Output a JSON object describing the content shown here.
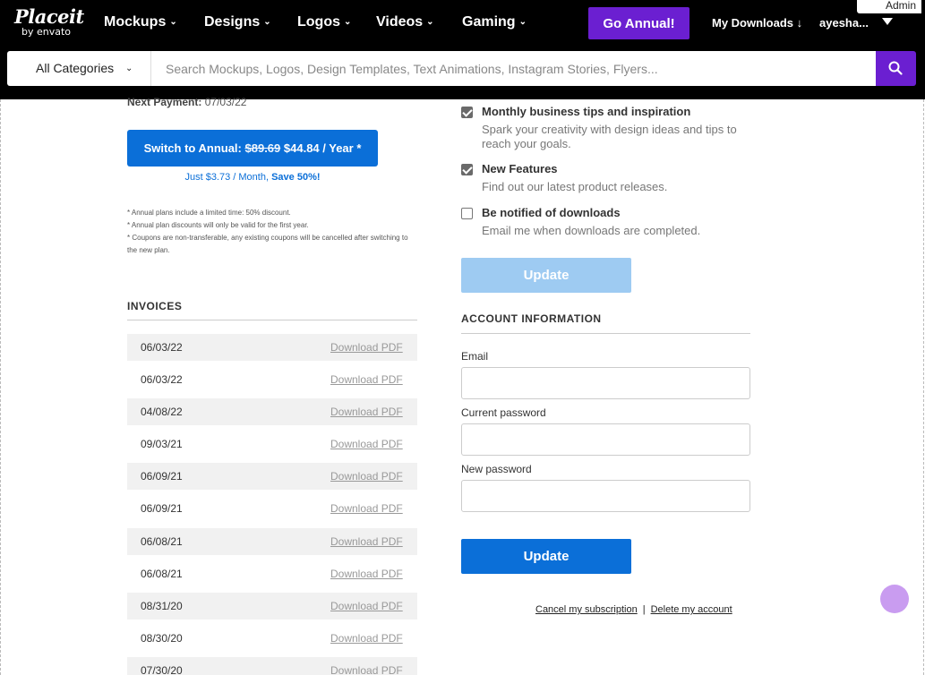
{
  "header": {
    "logo_brand": "Placeit",
    "logo_by": "by envato",
    "nav": [
      {
        "label": "Mockups"
      },
      {
        "label": "Designs"
      },
      {
        "label": "Logos"
      },
      {
        "label": "Videos"
      },
      {
        "label": "Gaming"
      }
    ],
    "go_annual": "Go Annual!",
    "my_downloads": "My Downloads",
    "user": "ayesha...",
    "admin": "Admin"
  },
  "search": {
    "category": "All Categories",
    "placeholder": "Search Mockups, Logos, Design Templates, Text Animations, Instagram Stories, Flyers..."
  },
  "billing": {
    "next_payment_label": "Next Payment:",
    "next_payment_date": "07/03/22",
    "switch_prefix": "Switch to Annual:",
    "old_price": "$89.69",
    "new_price": "$44.84 / Year *",
    "per_month": "Just $3.73 / Month,",
    "save": "Save 50%!",
    "notes": [
      "* Annual plans include a limited time: 50% discount.",
      "* Annual plan discounts will only be valid for the first year.",
      "* Coupons are non-transferable, any existing coupons will be cancelled after switching to the new plan."
    ]
  },
  "invoices": {
    "title": "INVOICES",
    "link_label": "Download PDF",
    "rows": [
      {
        "date": "06/03/22"
      },
      {
        "date": "06/03/22"
      },
      {
        "date": "04/08/22"
      },
      {
        "date": "09/03/21"
      },
      {
        "date": "06/09/21"
      },
      {
        "date": "06/09/21"
      },
      {
        "date": "06/08/21"
      },
      {
        "date": "06/08/21"
      },
      {
        "date": "08/31/20"
      },
      {
        "date": "08/30/20"
      },
      {
        "date": "07/30/20"
      }
    ]
  },
  "notifications": {
    "items": [
      {
        "title": "Monthly business tips and inspiration",
        "desc": "Spark your creativity with design ideas and tips to reach your goals.",
        "checked": true
      },
      {
        "title": "New Features",
        "desc": "Find out our latest product releases.",
        "checked": true
      },
      {
        "title": "Be notified of downloads",
        "desc": "Email me when downloads are completed.",
        "checked": false
      }
    ],
    "update_label": "Update"
  },
  "account": {
    "title": "ACCOUNT INFORMATION",
    "email_label": "Email",
    "email_value": "",
    "current_password_label": "Current password",
    "current_password_value": "",
    "new_password_label": "New password",
    "new_password_value": "",
    "update_label": "Update",
    "cancel_link": "Cancel my subscription",
    "separator": "|",
    "delete_link": "Delete my account"
  },
  "colors": {
    "brand_purple": "#6b1fd1",
    "primary_blue": "#0b6fd8",
    "disabled_blue": "#9ecbf2"
  }
}
